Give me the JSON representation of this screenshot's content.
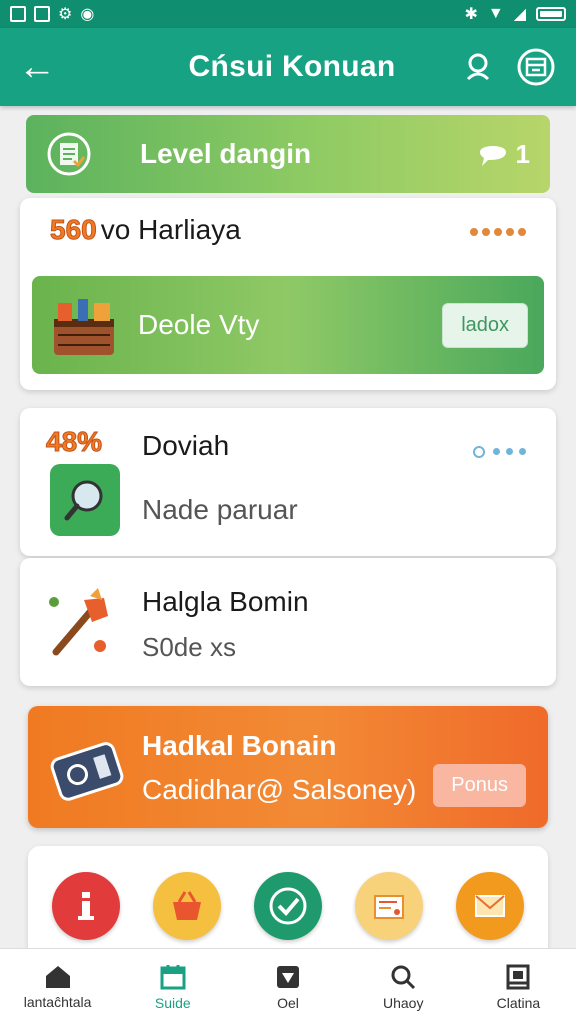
{
  "app_bar": {
    "title": "Cńsui Konuan"
  },
  "banner": {
    "title": "Level dangin",
    "badge_count": "1"
  },
  "card1": {
    "tag": "560",
    "title": "vo Harliaya",
    "body_label": "Deole Vty",
    "button": "ladox"
  },
  "card2": {
    "tag": "48%",
    "title": "Doviah",
    "subtitle": "Nade рaruar"
  },
  "card3": {
    "title": "Halgla Bomin",
    "subtitle": "S0de xs"
  },
  "promo": {
    "title": "Hadkal Bonain",
    "subtitle": "Cadidhar@ Salsoney)",
    "button": "Ponus"
  },
  "bottom_nav": [
    {
      "label": "lantaĉhtala",
      "icon": "home-icon",
      "active": false
    },
    {
      "label": "Suide",
      "icon": "calendar-icon",
      "active": true
    },
    {
      "label": "Oel",
      "icon": "badge-icon",
      "active": false
    },
    {
      "label": "Uhaoy",
      "icon": "search-icon",
      "active": false
    },
    {
      "label": "Clatina",
      "icon": "profile-card-icon",
      "active": false
    }
  ],
  "colors": {
    "primary": "#17a383",
    "accent_orange": "#f07a22",
    "green": "#5cb25e"
  }
}
